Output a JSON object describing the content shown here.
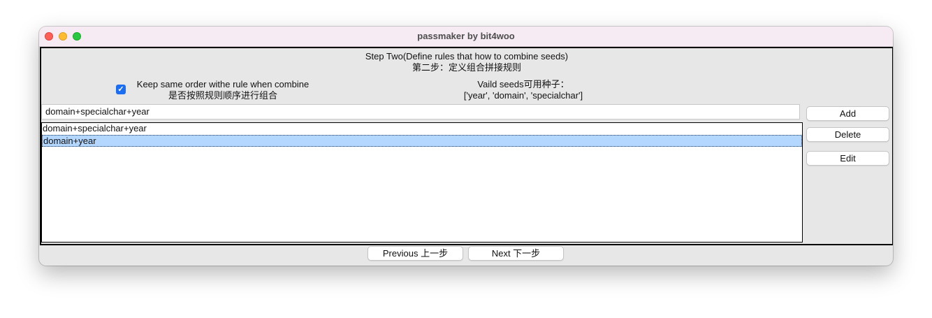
{
  "window": {
    "title": "passmaker by bit4woo"
  },
  "header": {
    "line1": "Step Two(Define rules that how to combine seeds)",
    "line2": "第二步：定义组合拼接规则"
  },
  "options": {
    "keep_order_checked": true,
    "keep_order_label_en": "Keep same order withe rule when combine",
    "keep_order_label_zh": "是否按照规则顺序进行组合"
  },
  "seeds": {
    "label": "Vaild seeds可用种子：",
    "values": "['year', 'domain', 'specialchar']"
  },
  "rule_input": {
    "value": "domain+specialchar+year"
  },
  "rules_list": {
    "items": [
      {
        "text": "domain+specialchar+year",
        "selected": false
      },
      {
        "text": "domain+year",
        "selected": true
      }
    ]
  },
  "side_buttons": {
    "add": "Add",
    "delete": "Delete",
    "edit": "Edit"
  },
  "nav_buttons": {
    "previous": "Previous 上一步",
    "next": "Next 下一步"
  },
  "colors": {
    "titlebar": "#f6eaf3",
    "selection": "#b3d7ff",
    "checkbox": "#1b6ef3",
    "close": "#fe5f57",
    "minimize": "#febc2e",
    "maximize": "#28c840"
  }
}
